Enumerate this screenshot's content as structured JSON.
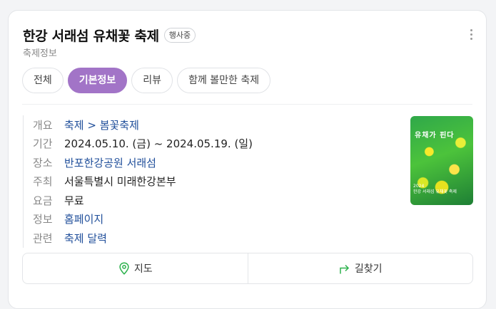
{
  "header": {
    "title": "한강 서래섬 유채꽃 축제",
    "status_badge": "행사중",
    "subtitle": "축제정보"
  },
  "tabs": [
    {
      "label": "전체"
    },
    {
      "label": "기본정보"
    },
    {
      "label": "리뷰"
    },
    {
      "label": "함께 볼만한 축제"
    }
  ],
  "info": {
    "overview": {
      "label": "개요",
      "value": "축제 > 봄꽃축제"
    },
    "period": {
      "label": "기간",
      "value": "2024.05.10. (금) ~  2024.05.19. (일)"
    },
    "place": {
      "label": "장소",
      "value": "반포한강공원 서래섬"
    },
    "host": {
      "label": "주최",
      "value": "서울특별시 미래한강본부"
    },
    "fee": {
      "label": "요금",
      "value": "무료"
    },
    "website": {
      "label": "정보",
      "value": "홈페이지"
    },
    "related": {
      "label": "관련",
      "value": "축제 달력"
    }
  },
  "poster": {
    "title": "유채가 핀다",
    "desc_line1": "2024",
    "desc_line2": "한강 서래섬 유채꽃 축제"
  },
  "actions": {
    "map_label": "지도",
    "directions_label": "길찾기"
  },
  "colors": {
    "accent": "#a274c7",
    "link": "#1f4e9a",
    "map_icon": "#2db24d"
  }
}
